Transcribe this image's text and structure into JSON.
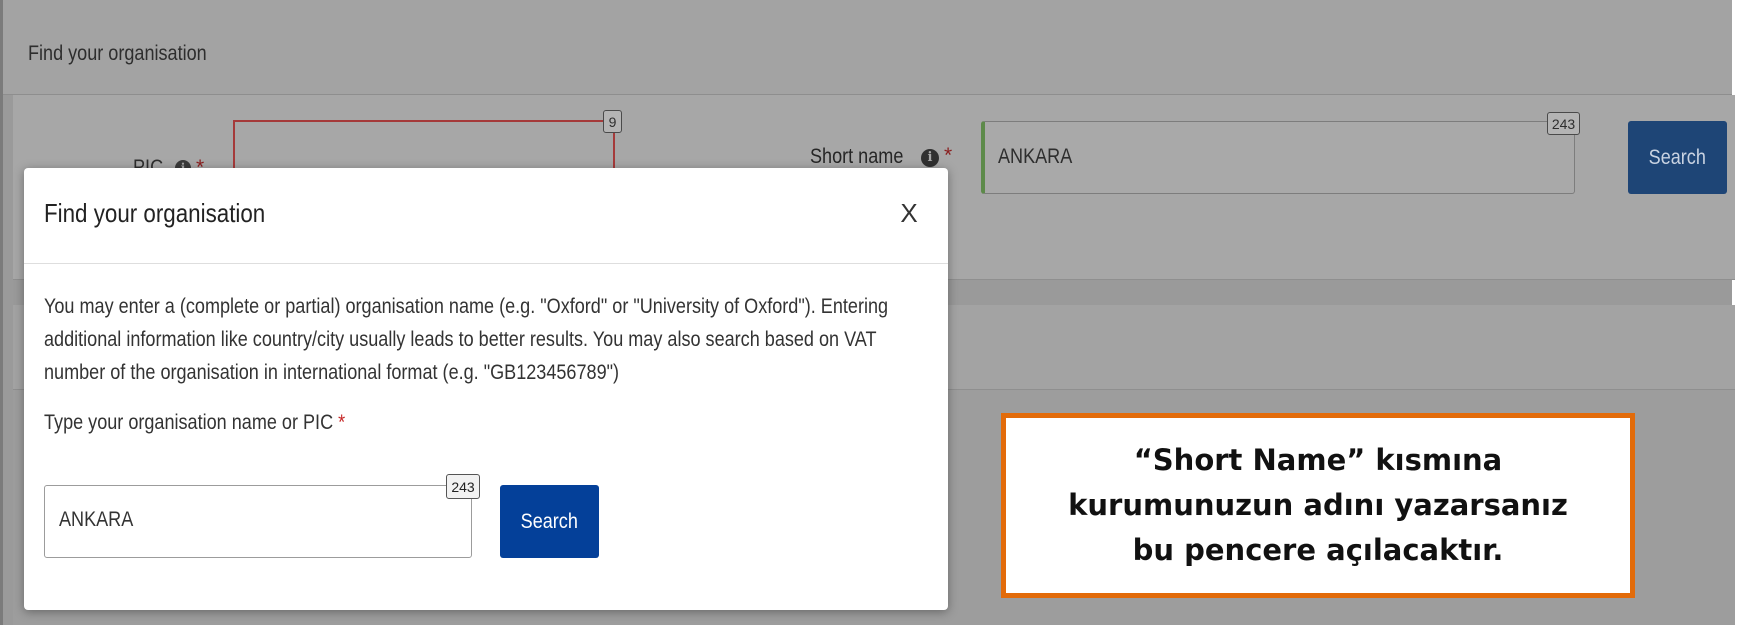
{
  "background_page": {
    "header_title": "Find your organisation",
    "pic_label": "PIC",
    "pic_required_mark": "*",
    "pic_counter": "9",
    "short_name_label": "Short name",
    "short_name_required_mark": "*",
    "short_name_value": "ANKARA",
    "short_name_counter": "243",
    "search_label": "Search",
    "info_icon": "info-circle-icon"
  },
  "modal": {
    "title": "Find your organisation",
    "close_label": "X",
    "description_lines": [
      "You may enter a (complete or partial) organisation name (e.g. \"Oxford\" or \"University of Oxford\"). Entering",
      "additional information like country/city usually leads to better results. You may also search based on VAT",
      "number of the organisation in international format (e.g. \"GB123456789\")"
    ],
    "field_label": "Type your organisation name or PIC",
    "field_required_mark": "*",
    "input_value": "ANKARA",
    "input_counter": "243",
    "search_label": "Search"
  },
  "callout": {
    "lines": [
      "“Short Name” kısmına",
      "kurumunuzun adını yazarsanız",
      "bu pencere açılacaktır."
    ],
    "border_color": "#e26b0a"
  },
  "colors": {
    "primary_button": "#044099",
    "required": "#c62828",
    "overlay": "#9a9a9a"
  }
}
